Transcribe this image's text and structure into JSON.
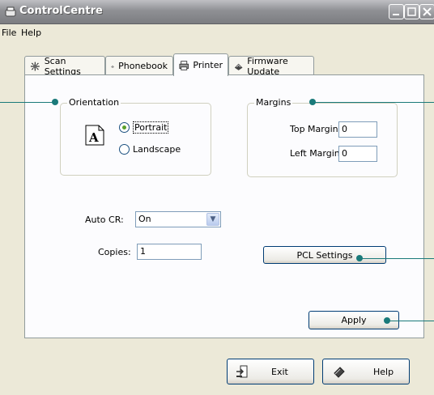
{
  "window": {
    "title": "ControlCentre"
  },
  "menu": {
    "file": "File",
    "help": "Help"
  },
  "tabs": [
    {
      "label": "Scan Settings",
      "icon": "scan-icon"
    },
    {
      "label": "Phonebook",
      "icon": "phonebook-icon"
    },
    {
      "label": "Printer",
      "icon": "printer-icon"
    },
    {
      "label": "Firmware Update",
      "icon": "firmware-icon"
    }
  ],
  "active_tab": "Printer",
  "orientation": {
    "legend": "Orientation",
    "portrait_label": "Portrait",
    "landscape_label": "Landscape",
    "selected": "Portrait",
    "preview_glyph": "A"
  },
  "margins": {
    "legend": "Margins",
    "top_label": "Top Margin:",
    "top_value": "0",
    "left_label": "Left Margin:",
    "left_value": "0"
  },
  "auto_cr": {
    "label": "Auto CR:",
    "value": "On"
  },
  "copies": {
    "label": "Copies:",
    "value": "1"
  },
  "buttons": {
    "pcl_settings": "PCL Settings",
    "apply": "Apply",
    "exit": "Exit",
    "help": "Help"
  },
  "colors": {
    "callout": "#1a7a7a",
    "titlebar": "#8f9094",
    "window_bg": "#ece9d8"
  }
}
